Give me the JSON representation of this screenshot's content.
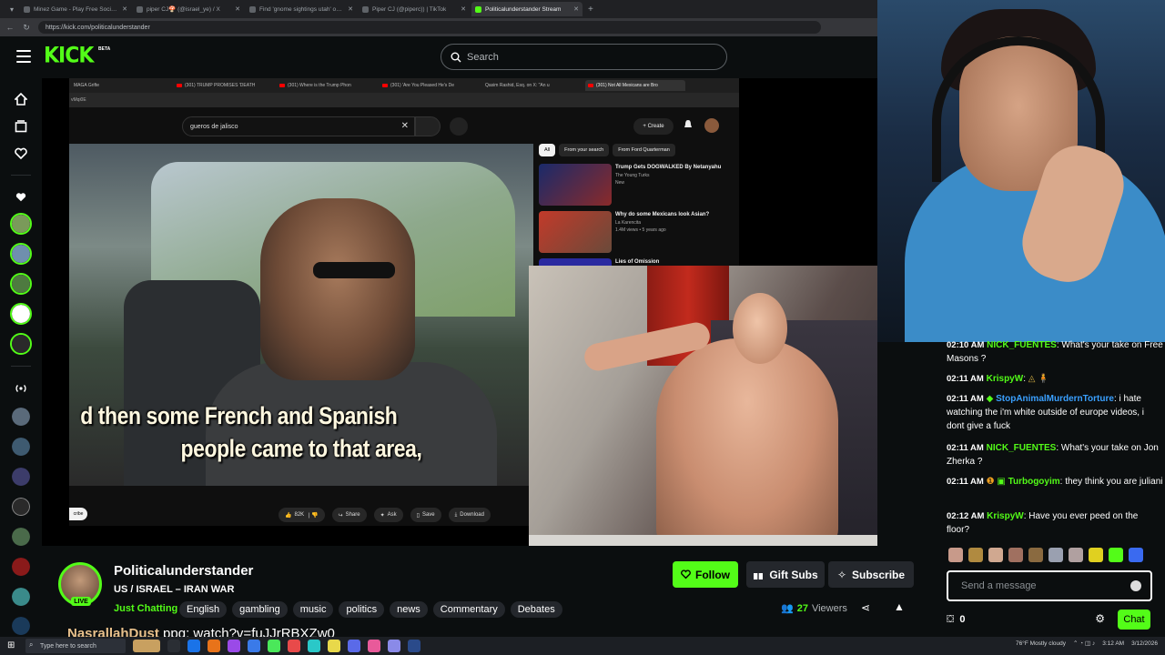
{
  "browser": {
    "tabs": [
      {
        "label": "Minez Game - Play Free Social Ca",
        "active": false
      },
      {
        "label": "piper CJ🍄 (@israel_ye) / X",
        "active": false
      },
      {
        "label": "Find 'gnome sightings utah' on Ti",
        "active": false
      },
      {
        "label": "Piper CJ (@piperc)) | TikTok",
        "active": false
      },
      {
        "label": "Politicalunderstander Stream",
        "active": true
      }
    ],
    "url": "https://kick.com/politicalunderstander"
  },
  "kick": {
    "logo": "KICK",
    "beta": "BETA",
    "search_placeholder": "Search",
    "accent": "#53fc18"
  },
  "sidebar": {
    "icons": [
      "home-icon",
      "browse-icon",
      "following-icon"
    ],
    "following_label_icon": "heart-icon",
    "avatars": [
      {
        "color": "#7a9a5a",
        "live": true
      },
      {
        "color": "#6f8fae",
        "live": true
      },
      {
        "color": "#4e7a40",
        "live": true
      },
      {
        "color": "#ffffff",
        "live": true
      },
      {
        "color": "#2a2a2a",
        "live": true
      }
    ],
    "recommended_icon": "broadcast-icon",
    "rec_avatars": [
      {
        "color": "#5a6a7a",
        "live": false
      },
      {
        "color": "#3e5a70",
        "live": false
      },
      {
        "color": "#3c3c6a",
        "live": false
      },
      {
        "color": "#2a2a2a",
        "live": false
      },
      {
        "color": "#4a6a4a",
        "live": false
      },
      {
        "color": "#8a1a1a",
        "live": false
      },
      {
        "color": "#3a8a8a",
        "live": false
      },
      {
        "color": "#1a3a5a",
        "live": false
      }
    ]
  },
  "stream": {
    "inner_tabs": [
      "MAGA Grifte",
      "(301) TRUMP PROMISES 'DEATH",
      "(301) Where is the Trump Phon",
      "(301) 'Are You Pleased He's De",
      "Qasim Rashid, Esq. on X: \"An u",
      "(301) Not All Mexicans are Bro"
    ],
    "inner_url": "vMqi0E",
    "yt_search_value": "gueros de jalisco",
    "yt_create": "Create",
    "subtitle_line1": "d then some French and Spanish",
    "subtitle_line2": "people came to that area,",
    "subscribe_stub": "cribe",
    "actions": [
      "82K",
      "Share",
      "Ask",
      "Save",
      "Download"
    ],
    "chips": [
      "All",
      "From your search",
      "From Ford Quarterman"
    ],
    "recs": [
      {
        "title": "Trump Gets DOGWALKED By Netanyahu",
        "channel": "The Young Turks",
        "stats": "New",
        "dur": "18:46",
        "thumb": "#3a5a9a"
      },
      {
        "title": "Why do some Mexicans look Asian?",
        "channel": "La Karencita",
        "stats": "1.4M views • 5 years ago",
        "dur": "12:22",
        "thumb": "#9a6a4a"
      },
      {
        "title": "Lies of Omission",
        "channel": "",
        "stats": "",
        "dur": "",
        "thumb": "#2a2aa0"
      }
    ]
  },
  "channel": {
    "name": "Politicalunderstander",
    "live_badge": "LIVE",
    "title": "US / ISRAEL – IRAN WAR",
    "category": "Just Chatting",
    "tags": [
      "English",
      "gambling",
      "music",
      "politics",
      "news",
      "Commentary",
      "Debates"
    ],
    "follow": "Follow",
    "gift_subs": "Gift Subs",
    "subscribe": "Subscribe",
    "viewers_count": "27",
    "viewers_label": "Viewers",
    "ticker_user": "NasrallahDust",
    "ticker_msg": "ppg: watch?v=fuJJrRBXZw0"
  },
  "chat": {
    "messages": [
      {
        "time": "02:10 AM",
        "user": "NICK_FUENTES",
        "color": "#53fc18",
        "text": "What's your take on Free Masons ?",
        "badge": ""
      },
      {
        "time": "02:11 AM",
        "user": "KrispyW",
        "color": "#53fc18",
        "text": "",
        "badge": "emotes"
      },
      {
        "time": "02:11 AM",
        "user": "StopAnimalMurdernTorture",
        "color": "#3aa0ff",
        "text": "i hate watching the i'm white outside of europe videos, i dont give a fuck",
        "badge": "diamond"
      },
      {
        "time": "02:11 AM",
        "user": "NICK_FUENTES",
        "color": "#53fc18",
        "text": "What's your take on Jon Zherka ?",
        "badge": ""
      },
      {
        "time": "02:11 AM",
        "user": "Turbogoyim",
        "color": "#53fc18",
        "text": "they think you are juliani",
        "badge": "sub"
      },
      {
        "time": "02:12 AM",
        "user": "KrispyW",
        "color": "#53fc18",
        "text": "Have you ever peed on the floor?",
        "badge": ""
      }
    ],
    "input_placeholder": "Send a message",
    "points": "0",
    "send": "Chat"
  },
  "taskbar": {
    "search_placeholder": "Type here to search",
    "weather": "76°F  Mostly cloudy",
    "time": "3:12 AM",
    "date": "3/12/2026"
  }
}
